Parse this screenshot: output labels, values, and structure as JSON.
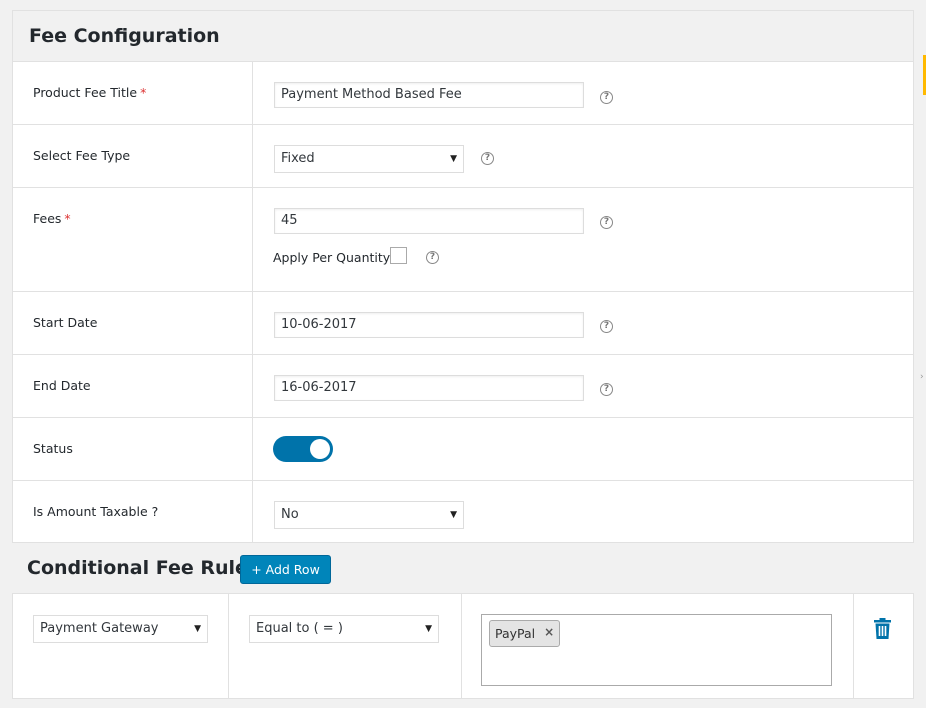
{
  "fee_config": {
    "title": "Fee Configuration",
    "product_fee_title": {
      "label": "Product Fee Title",
      "required": "*",
      "value": "Payment Method Based Fee"
    },
    "select_fee_type": {
      "label": "Select Fee Type",
      "value": "Fixed"
    },
    "fees": {
      "label": "Fees",
      "required": "*",
      "value": "45",
      "apply_per_quantity_label": "Apply Per Quantity"
    },
    "start_date": {
      "label": "Start Date",
      "value": "10-06-2017"
    },
    "end_date": {
      "label": "End Date",
      "value": "16-06-2017"
    },
    "status": {
      "label": "Status",
      "enabled": true
    },
    "is_amount_taxable": {
      "label": "Is Amount Taxable ?",
      "value": "No"
    }
  },
  "conditional_fee_rule": {
    "title": "Conditional Fee Rule",
    "add_row_label": "+ Add Row",
    "rule": {
      "condition": "Payment Gateway",
      "operator": "Equal to ( = )",
      "tags": [
        "PayPal"
      ]
    }
  },
  "icons": {
    "help": "help-circle-icon",
    "dropdown": "triangle-down-icon",
    "tag_remove": "close-icon",
    "delete": "trash-icon"
  },
  "glyphs": {
    "help": "?",
    "arrow": "▼",
    "remove": "×"
  },
  "colors": {
    "primary": "#0073aa",
    "button": "#0085ba",
    "required": "#dc3232",
    "trash": "#0073aa"
  }
}
